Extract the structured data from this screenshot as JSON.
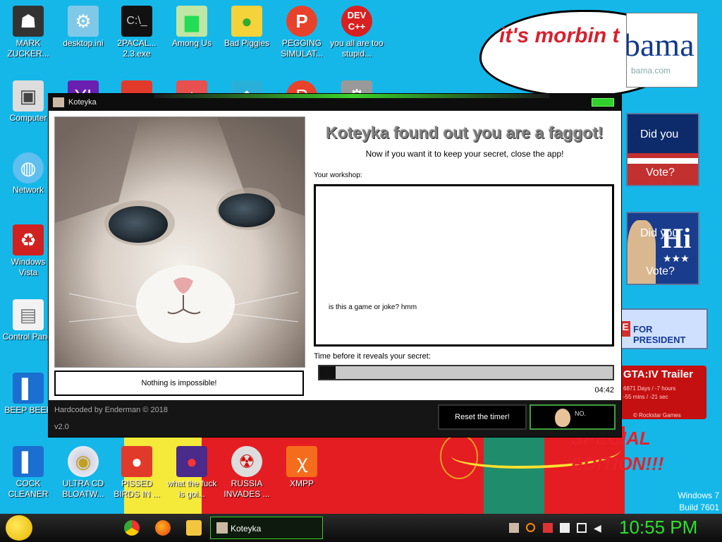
{
  "desktop": {
    "icons": [
      {
        "label": "MARK ZUCKER...",
        "icon": "zuckerberg-figure-icon"
      },
      {
        "label": "desktop.ini",
        "icon": "ini-file-icon"
      },
      {
        "label": "2PACAL... 2.3.exe",
        "icon": "console-exe-icon"
      },
      {
        "label": "Among Us",
        "icon": "among-us-icon"
      },
      {
        "label": "Bad Piggies",
        "icon": "bad-piggies-icon"
      },
      {
        "label": "PEGGING SIMULAT...",
        "icon": "pegging-icon"
      },
      {
        "label": "you all are too stupid...",
        "icon": "dev-cpp-icon"
      },
      {
        "label": "Computer",
        "icon": "computer-icon"
      },
      {
        "label": "Network",
        "icon": "network-icon"
      },
      {
        "label": "Windows Vista",
        "icon": "recycle-bin-icon"
      },
      {
        "label": "Control Panel",
        "icon": "control-panel-icon"
      },
      {
        "label": "BEEP BEEP",
        "icon": "blue-file-icon"
      },
      {
        "label": "COCK CLEANER",
        "icon": "blue-file-icon"
      },
      {
        "label": "ULTRA CD BLOATW...",
        "icon": "cd-icon"
      },
      {
        "label": "PISSED BIRDS IN ...",
        "icon": "angry-birds-icon"
      },
      {
        "label": "what the fuck is goi...",
        "icon": "angry-birds-space-icon"
      },
      {
        "label": "RUSSIA INVADES ...",
        "icon": "radiation-icon"
      },
      {
        "label": "XMPP",
        "icon": "xampp-icon"
      }
    ],
    "wallpaper": {
      "morbin_text": "it's morbin t",
      "obama_logo": "bama",
      "obama_url": "bama.com",
      "did_you": "Did you",
      "vote": "Vote?",
      "hi": "Hi",
      "president_text": "FOR PRESIDENT",
      "president_e": "E",
      "gta_title": "GTA:IV Trailer",
      "gta_line1": "6871 Days / -7 hours",
      "gta_line2": "-55 mins / -21 sec",
      "gta_line3": "© Rockstar Games",
      "special": "SPECIAL",
      "edition": "EDITION!!!",
      "windows_label": "Windows 7",
      "build_label": "Build 7601"
    }
  },
  "window": {
    "title": "Koteyka",
    "headline": "Koteyka found out you are a faggot!",
    "subline": "Now if you want it to keep your secret, close the app!",
    "caption": "Nothing is impossible!",
    "workshop_label": "Your workshop:",
    "workshop_text": "is this a game or joke? hmm",
    "time_label": "Time before it reveals your secret:",
    "timer": "04:42",
    "progress_fraction": 0.055,
    "credit": "Hardcoded by Enderman © 2018",
    "version": "v2.0",
    "reset_button": "Reset the timer!",
    "baldi_note": "NO."
  },
  "taskbar": {
    "active_app": "Koteyka",
    "clock": "10:55 PM",
    "pinned": [
      "chrome-icon",
      "firefox-icon",
      "folder-icon"
    ],
    "tray": [
      "cat-icon",
      "search-icon",
      "flag-icon",
      "action-center-icon",
      "network-icon",
      "volume-icon"
    ]
  },
  "colors": {
    "desktop_bg": "#15b7e9",
    "accent_green": "#3bd12b",
    "clock_green": "#2ce02c"
  }
}
